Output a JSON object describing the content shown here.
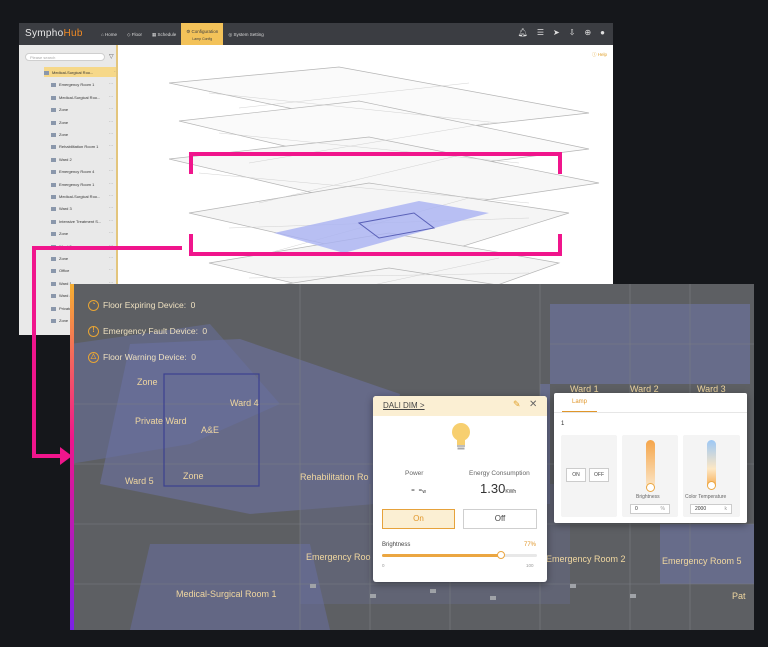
{
  "app": {
    "logo_main": "Sympho",
    "logo_accent": "Hub"
  },
  "nav": [
    {
      "label": "Home",
      "icon": "home-icon"
    },
    {
      "label": "Floor",
      "icon": "floor-icon"
    },
    {
      "label": "Schedule",
      "icon": "calendar-icon"
    },
    {
      "label": "Configuration",
      "sub": "Lamp Config",
      "icon": "config-icon",
      "active": true
    },
    {
      "label": "System Setting",
      "icon": "settings-icon"
    }
  ],
  "top_icons": [
    "bell-icon",
    "menu-icon",
    "send-icon",
    "download-icon",
    "globe-icon",
    "user-icon"
  ],
  "sidebar": {
    "search_placeholder": "Please search",
    "items": [
      "Medical-Surgical Roo...",
      "Emergency Room 1",
      "Medical-Surgical Roo...",
      "Zone",
      "Zone",
      "Zone",
      "Rehabilitation Room 1",
      "Ward 2",
      "Emergency Room 4",
      "Emergency Room 1",
      "Medical-Surgical Roo...",
      "Ward 3",
      "Intensive Treatment S...",
      "Zone",
      "Ward 5",
      "Zone",
      "Office",
      "Ward 1",
      "Ward 4",
      "Private Ward",
      "Zone"
    ]
  },
  "help_label": "Help",
  "status": [
    {
      "label": "Floor Expiring Device:",
      "count": "0",
      "icon": "clock-icon"
    },
    {
      "label": "Emergency Fault Device:",
      "count": "0",
      "icon": "fault-icon"
    },
    {
      "label": "Floor Warning Device:",
      "count": "0",
      "icon": "warning-icon"
    }
  ],
  "rooms": [
    "Zone",
    "Ward 4",
    "Private Ward",
    "A&E",
    "Ward 5",
    "Zone",
    "Rehabilitation Ro",
    "Ward 1",
    "Ward 2",
    "Ward 3",
    "Emergency Roo",
    "Emergency Room 2",
    "Emergency Room 5",
    "Medical-Surgical Room 1",
    "Pat"
  ],
  "dali": {
    "title": "DALI DIM >",
    "power_label": "Power",
    "power_value": "- -",
    "power_unit": "w",
    "energy_label": "Energy Consumption",
    "energy_value": "1.30",
    "energy_unit": "KWh",
    "on_label": "On",
    "off_label": "Off",
    "brightness_label": "Brightness",
    "brightness_value": "77%",
    "brightness_fraction": 0.77,
    "min_label": "0",
    "max_label": "100"
  },
  "lamp": {
    "tab_label": "Lamp",
    "number": "1",
    "on_label": "ON",
    "off_label": "OFF",
    "brightness_label": "Brightness",
    "brightness_value": "0",
    "brightness_unit": "%",
    "color_temp_label": "Color Temperature",
    "color_temp_value": "2000",
    "color_temp_unit": "k"
  },
  "colors": {
    "accent": "#f3c259",
    "highlight": "#f0158c",
    "zone_fill": "#8d95d6"
  }
}
